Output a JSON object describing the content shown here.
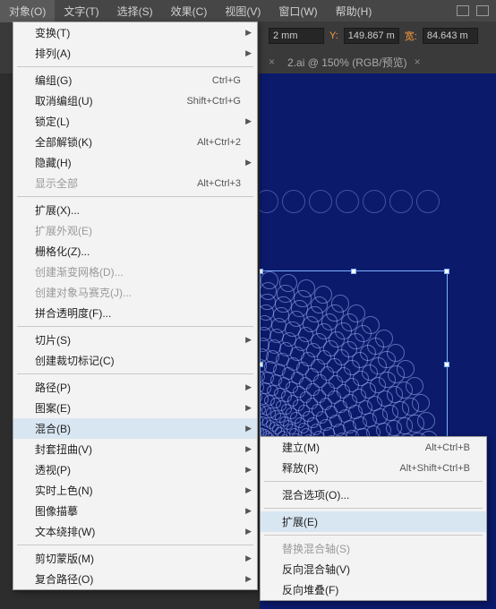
{
  "menubar": {
    "items": [
      "对象(O)",
      "文字(T)",
      "选择(S)",
      "效果(C)",
      "视图(V)",
      "窗口(W)",
      "帮助(H)"
    ]
  },
  "toolbar": {
    "x_value": "2 mm",
    "y_label": "Y:",
    "y_value": "149.867 m",
    "w_label": "宽:",
    "w_value": "84.643 m"
  },
  "tabs": {
    "t1_close": "×",
    "t2_label": "2.ai @ 150% (RGB/预览)",
    "t2_close": "×"
  },
  "menu": [
    {
      "label": "变换(T)",
      "sub": true
    },
    {
      "label": "排列(A)",
      "sub": true
    },
    {
      "sep": true
    },
    {
      "label": "编组(G)",
      "sc": "Ctrl+G"
    },
    {
      "label": "取消编组(U)",
      "sc": "Shift+Ctrl+G"
    },
    {
      "label": "锁定(L)",
      "sub": true
    },
    {
      "label": "全部解锁(K)",
      "sc": "Alt+Ctrl+2"
    },
    {
      "label": "隐藏(H)",
      "sub": true
    },
    {
      "label": "显示全部",
      "sc": "Alt+Ctrl+3",
      "dis": true
    },
    {
      "sep": true
    },
    {
      "label": "扩展(X)..."
    },
    {
      "label": "扩展外观(E)",
      "dis": true
    },
    {
      "label": "栅格化(Z)..."
    },
    {
      "label": "创建渐变网格(D)...",
      "dis": true
    },
    {
      "label": "创建对象马赛克(J)...",
      "dis": true
    },
    {
      "label": "拼合透明度(F)..."
    },
    {
      "sep": true
    },
    {
      "label": "切片(S)",
      "sub": true
    },
    {
      "label": "创建裁切标记(C)"
    },
    {
      "sep": true
    },
    {
      "label": "路径(P)",
      "sub": true
    },
    {
      "label": "图案(E)",
      "sub": true
    },
    {
      "label": "混合(B)",
      "sub": true,
      "hl": true
    },
    {
      "label": "封套扭曲(V)",
      "sub": true
    },
    {
      "label": "透视(P)",
      "sub": true
    },
    {
      "label": "实时上色(N)",
      "sub": true
    },
    {
      "label": "图像描摹",
      "sub": true
    },
    {
      "label": "文本绕排(W)",
      "sub": true
    },
    {
      "sep": true
    },
    {
      "label": "剪切蒙版(M)",
      "sub": true
    },
    {
      "label": "复合路径(O)",
      "sub": true
    }
  ],
  "submenu": [
    {
      "label": "建立(M)",
      "sc": "Alt+Ctrl+B"
    },
    {
      "label": "释放(R)",
      "sc": "Alt+Shift+Ctrl+B"
    },
    {
      "sep": true
    },
    {
      "label": "混合选项(O)..."
    },
    {
      "sep": true
    },
    {
      "label": "扩展(E)",
      "hl": true
    },
    {
      "sep": true
    },
    {
      "label": "替换混合轴(S)",
      "dis": true
    },
    {
      "label": "反向混合轴(V)"
    },
    {
      "label": "反向堆叠(F)"
    }
  ]
}
